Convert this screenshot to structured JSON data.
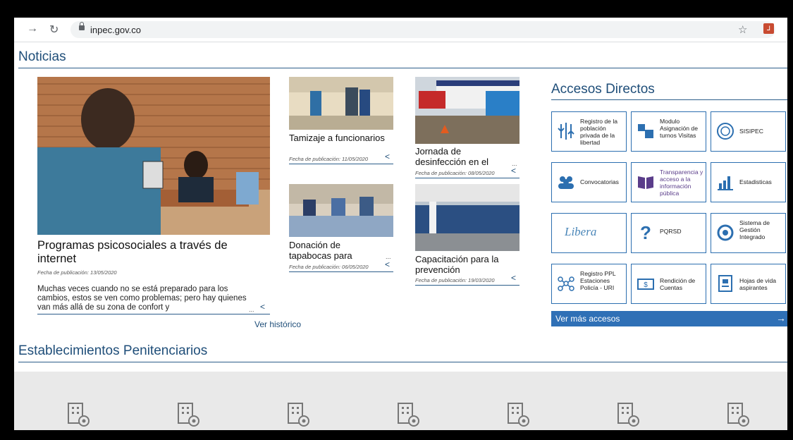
{
  "browser": {
    "url": "inpec.gov.co",
    "back_icon": "arrow-right-icon",
    "reload_icon": "reload-icon"
  },
  "noticias": {
    "title": "Noticias",
    "main": {
      "title": "Programas psicosociales a través de internet",
      "date": "Fecha de publicación: 13/05/2020",
      "summary": "Muchas veces cuando no se está preparado para los cambios, estos se ven como problemas; pero hay quienes van más allá de su zona de confort y"
    },
    "items": [
      {
        "title": "Tamizaje a funcionarios",
        "date": "Fecha de publicación: 11/05/2020"
      },
      {
        "title": "Jornada de desinfección en el",
        "date": "Fecha de publicación: 08/05/2020"
      },
      {
        "title": "Donación de tapabocas para",
        "date": "Fecha de publicación: 06/05/2020"
      },
      {
        "title": "Capacitación para la prevención",
        "date": "Fecha de publicación: 19/03/2020"
      }
    ],
    "ellipsis": "...",
    "historico": "Ver histórico"
  },
  "accesos": {
    "title": "Accesos Directos",
    "tiles": [
      {
        "label": "Registro de la población privada de la libertad",
        "icon": "population-registry-icon"
      },
      {
        "label": "Modulo Asignación de turnos Visitas",
        "icon": "visit-turns-icon"
      },
      {
        "label": "SISIPEC",
        "icon": "sisipec-seal-icon"
      },
      {
        "label": "Convocatorias",
        "icon": "people-group-icon"
      },
      {
        "label": "Transparencia y acceso a la información pública",
        "icon": "open-book-icon"
      },
      {
        "label": "Estadisticas",
        "icon": "bar-chart-icon"
      },
      {
        "label": "Libera",
        "icon": "libera-logo"
      },
      {
        "label": "PQRSD",
        "icon": "question-icon"
      },
      {
        "label": "Sistema de Gestión Integrado",
        "icon": "management-cycle-icon"
      },
      {
        "label": "Registro PPL Estaciones Policía - URI",
        "icon": "network-nodes-icon"
      },
      {
        "label": "Rendición de Cuentas",
        "icon": "money-bill-icon"
      },
      {
        "label": "Hojas de vida aspirantes",
        "icon": "resume-document-icon"
      }
    ],
    "ver_mas": "Ver más accesos",
    "ver_mas_arrow": "→",
    "share_glyph": "<"
  },
  "establecimientos": {
    "title": "Establecimientos Penitenciarios",
    "icon": "building-location-icon",
    "count_icons": 7
  },
  "colors": {
    "brand_blue": "#1f4e79",
    "button_blue": "#2f70b6",
    "tile_border": "#2c6fb0"
  }
}
